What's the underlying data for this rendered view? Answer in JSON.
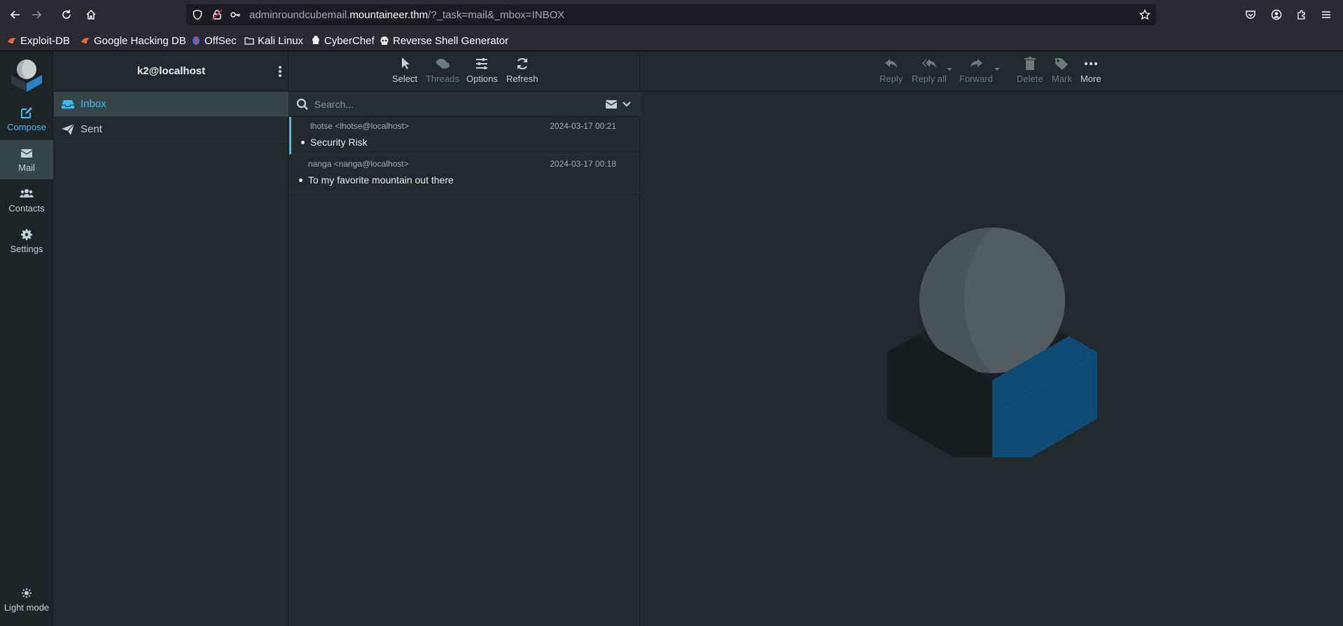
{
  "browser": {
    "url_prefix": "adminroundcubemail.",
    "url_host": "mountaineer.thm",
    "url_path": "/?_task=mail&_mbox=INBOX"
  },
  "bookmarks": [
    {
      "label": "Exploit-DB",
      "icon": "exploit-db-icon"
    },
    {
      "label": "Google Hacking DB",
      "icon": "ghdb-icon"
    },
    {
      "label": "OffSec",
      "icon": "offsec-icon"
    },
    {
      "label": "Kali Linux",
      "icon": "folder-icon"
    },
    {
      "label": "CyberChef",
      "icon": "chef-icon"
    },
    {
      "label": "Reverse Shell Generator",
      "icon": "skull-icon"
    }
  ],
  "taskmenu": {
    "compose": "Compose",
    "mail": "Mail",
    "contacts": "Contacts",
    "settings": "Settings",
    "light_mode": "Light mode"
  },
  "folders": {
    "account": "k2@localhost",
    "items": [
      {
        "label": "Inbox",
        "icon": "inbox-icon"
      },
      {
        "label": "Sent",
        "icon": "paper-plane-icon"
      }
    ]
  },
  "list_toolbar": {
    "select": "Select",
    "threads": "Threads",
    "options": "Options",
    "refresh": "Refresh"
  },
  "search": {
    "placeholder": "Search..."
  },
  "messages": [
    {
      "from": "lhotse <lhotse@localhost>",
      "date": "2024-03-17 00:21",
      "subject": "Security Risk"
    },
    {
      "from": "nanga <nanga@localhost>",
      "date": "2024-03-17 00:18",
      "subject": "To my favorite mountain out there"
    }
  ],
  "content_toolbar": {
    "reply": "Reply",
    "reply_all": "Reply all",
    "forward": "Forward",
    "delete": "Delete",
    "mark": "Mark",
    "more": "More"
  },
  "colors": {
    "accent": "#37beff",
    "background": "#21292c",
    "logo_blue": "#0f4c75"
  }
}
